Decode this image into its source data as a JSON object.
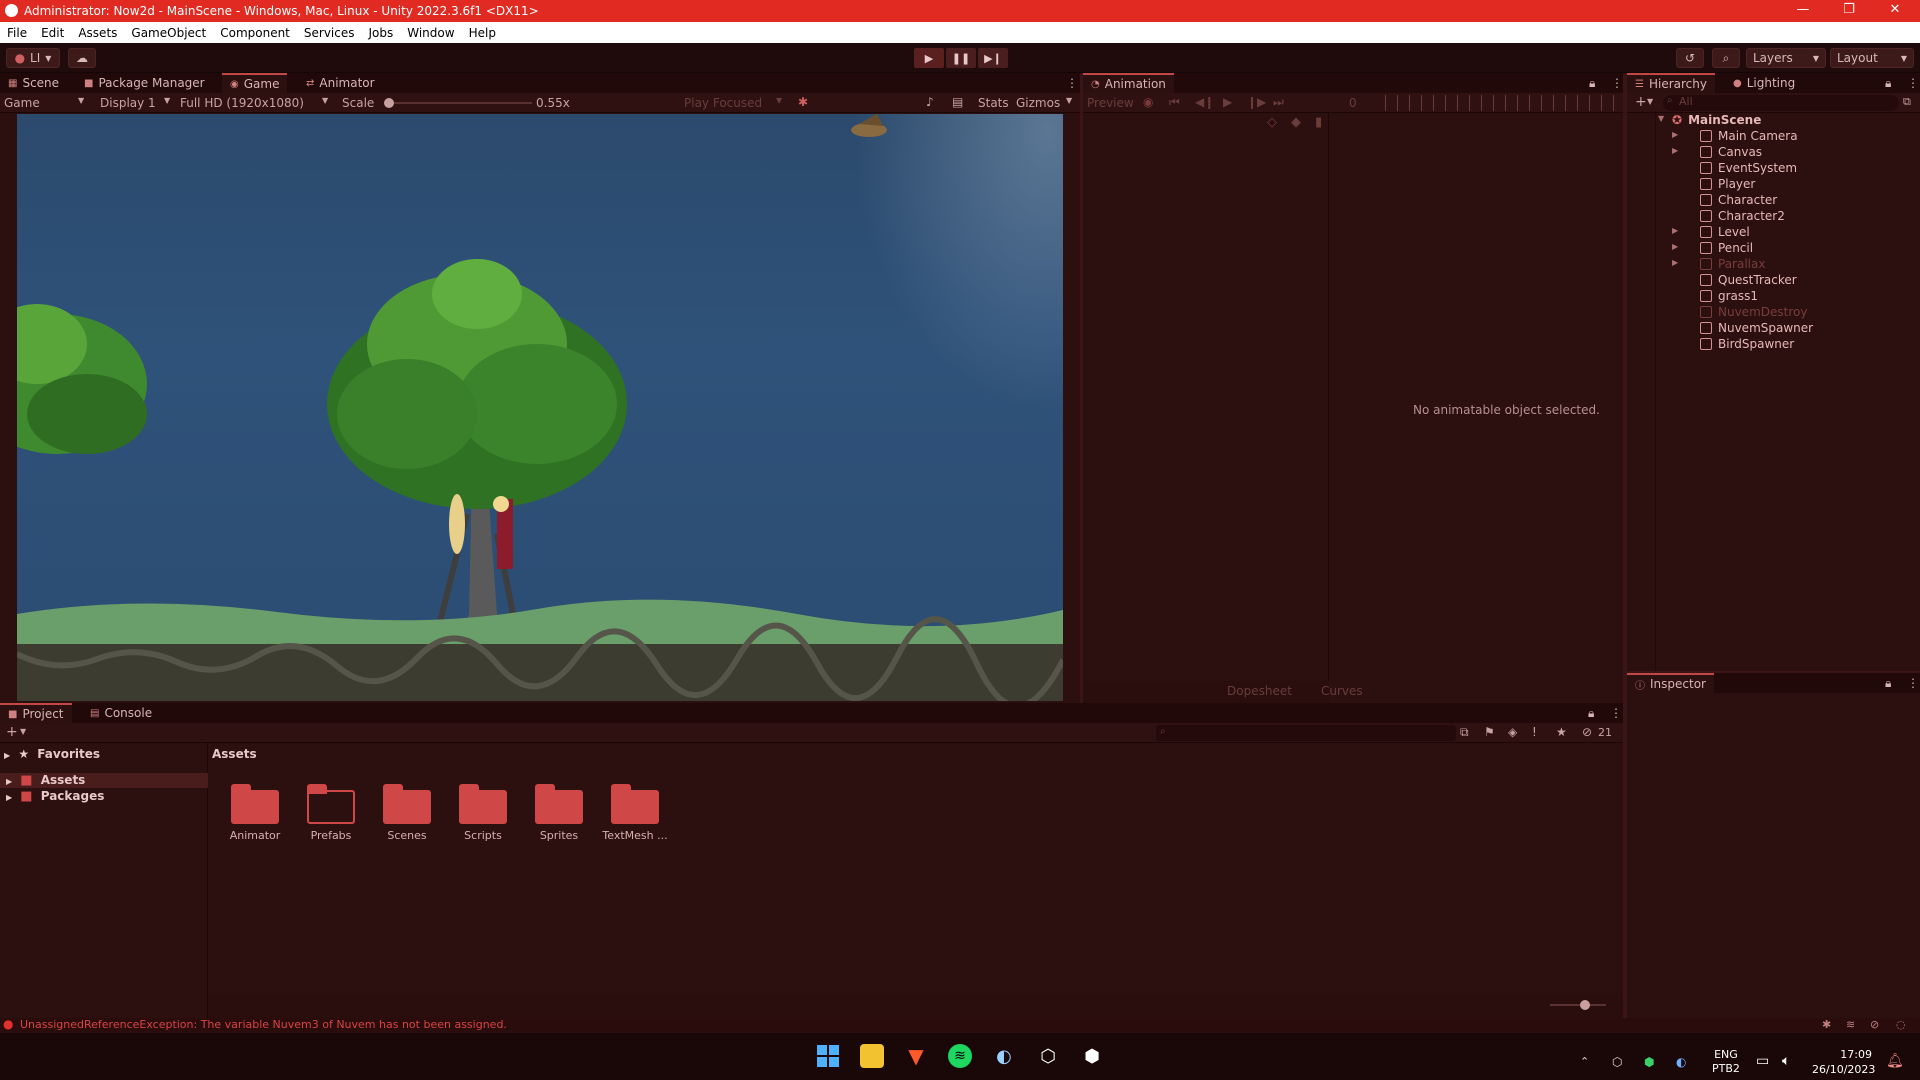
{
  "window": {
    "title": "Administrator: Now2d - MainScene - Windows, Mac, Linux - Unity 2022.3.6f1 <DX11>",
    "minimize": "—",
    "restore": "❐",
    "close": "✕"
  },
  "menu": [
    "File",
    "Edit",
    "Assets",
    "GameObject",
    "Component",
    "Services",
    "Jobs",
    "Window",
    "Help"
  ],
  "toolbar": {
    "account": "LI",
    "layers": "Layers",
    "layout": "Layout"
  },
  "scene_panel": {
    "tabs": [
      "Scene",
      "Package Manager",
      "Game",
      "Animator"
    ],
    "active_tab": "Game",
    "game_dropdown": "Game",
    "display": "Display 1",
    "resolution": "Full HD (1920x1080)",
    "scale_label": "Scale",
    "scale_value": "0.55x",
    "scale_fraction": 0.0,
    "play_focused": "Play Focused",
    "stats": "Stats",
    "gizmos": "Gizmos"
  },
  "animation_panel": {
    "tab": "Animation",
    "preview": "Preview",
    "frame": "0",
    "empty_message": "No animatable object selected.",
    "dopesheet": "Dopesheet",
    "curves": "Curves"
  },
  "hierarchy": {
    "tabs": [
      "Hierarchy",
      "Lighting"
    ],
    "search_placeholder": "All",
    "scene": "MainScene",
    "items": [
      {
        "name": "Main Camera",
        "expandable": true,
        "dim": false
      },
      {
        "name": "Canvas",
        "expandable": true,
        "dim": false
      },
      {
        "name": "EventSystem",
        "expandable": false,
        "dim": false
      },
      {
        "name": "Player",
        "expandable": false,
        "dim": false
      },
      {
        "name": "Character",
        "expandable": false,
        "dim": false
      },
      {
        "name": "Character2",
        "expandable": false,
        "dim": false
      },
      {
        "name": "Level",
        "expandable": true,
        "dim": false
      },
      {
        "name": "Pencil",
        "expandable": true,
        "dim": false
      },
      {
        "name": "Parallax",
        "expandable": true,
        "dim": true
      },
      {
        "name": "QuestTracker",
        "expandable": false,
        "dim": false
      },
      {
        "name": "grass1",
        "expandable": false,
        "dim": false
      },
      {
        "name": "NuvemDestroy",
        "expandable": false,
        "dim": true
      },
      {
        "name": "NuvemSpawner",
        "expandable": false,
        "dim": false
      },
      {
        "name": "BirdSpawner",
        "expandable": false,
        "dim": false
      }
    ]
  },
  "inspector": {
    "tab": "Inspector"
  },
  "project": {
    "tabs": [
      "Project",
      "Console"
    ],
    "favorites": "Favorites",
    "tree": [
      "Assets",
      "Packages"
    ],
    "breadcrumb": "Assets",
    "hidden_count": "21",
    "folders": [
      {
        "name": "Animator",
        "outline": false
      },
      {
        "name": "Prefabs",
        "outline": true
      },
      {
        "name": "Scenes",
        "outline": false
      },
      {
        "name": "Scripts",
        "outline": false
      },
      {
        "name": "Sprites",
        "outline": false
      },
      {
        "name": "TextMesh ...",
        "outline": false
      }
    ]
  },
  "status": {
    "error": "UnassignedReferenceException: The variable Nuvem3 of Nuvem has not been assigned."
  },
  "taskbar": {
    "lang1": "ENG",
    "lang2": "PTB2",
    "time": "17:09",
    "date": "26/10/2023"
  },
  "colors": {
    "accent": "#e02a22",
    "panel": "#2c0f0f",
    "folder": "#cf4747"
  }
}
